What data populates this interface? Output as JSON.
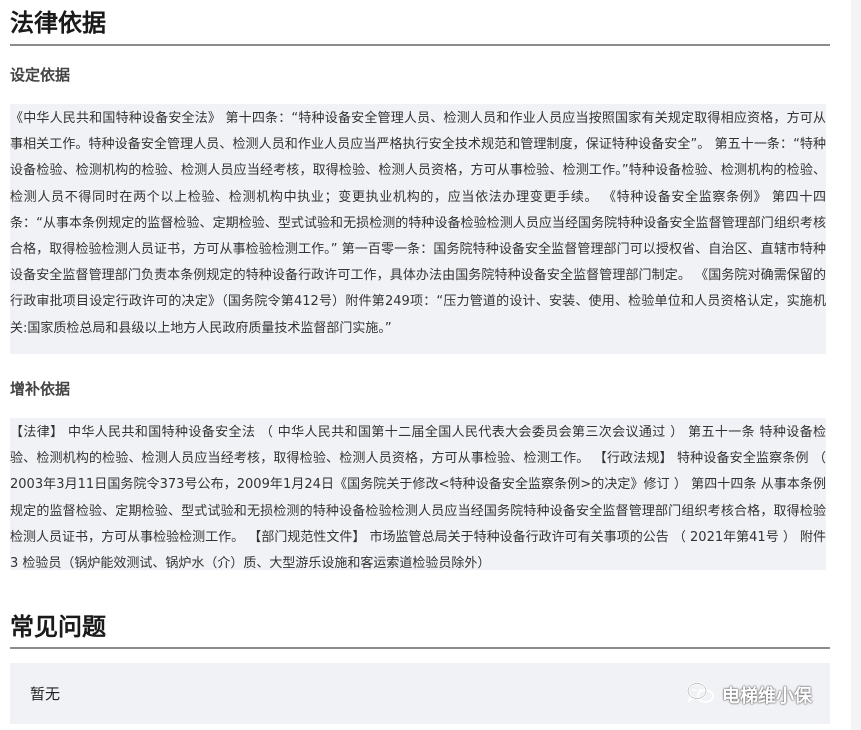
{
  "legal_basis": {
    "title": "法律依据",
    "establishing": {
      "title": "设定依据",
      "text": "《中华人民共和国特种设备安全法》 第十四条：“特种设备安全管理人员、检测人员和作业人员应当按照国家有关规定取得相应资格，方可从事相关工作。特种设备安全管理人员、检测人员和作业人员应当严格执行安全技术规范和管理制度，保证特种设备安全”。 第五十一条：“特种设备检验、检测机构的检验、检测人员应当经考核，取得检验、检测人员资格，方可从事检验、检测工作。”特种设备检验、检测机构的检验、检测人员不得同时在两个以上检验、检测机构中执业；变更执业机构的，应当依法办理变更手续。 《特种设备安全监察条例》 第四十四条：“从事本条例规定的监督检验、定期检验、型式试验和无损检测的特种设备检验检测人员应当经国务院特种设备安全监督管理部门组织考核合格，取得检验检测人员证书，方可从事检验检测工作。” 第一百零一条：国务院特种设备安全监督管理部门可以授权省、自治区、直辖市特种设备安全监督管理部门负责本条例规定的特种设备行政许可工作，具体办法由国务院特种设备安全监督管理部门制定。 《国务院对确需保留的行政审批项目设定行政许可的决定》（国务院令第412号）附件第249项：“压力管道的设计、安装、使用、检验单位和人员资格认定，实施机关:国家质检总局和县级以上地方人民政府质量技术监督部门实施。”"
    },
    "supplementary": {
      "title": "增补依据",
      "text": "【法律】 中华人民共和国特种设备安全法 （ 中华人民共和国第十二届全国人民代表大会委员会第三次会议通过 ） 第五十一条 特种设备检验、检测机构的检验、检测人员应当经考核，取得检验、检测人员资格，方可从事检验、检测工作。 【行政法规】 特种设备安全监察条例 （ 2003年3月11日国务院令373号公布，2009年1月24日《国务院关于修改<特种设备安全监察条例>的决定》修订 ） 第四十四条 从事本条例规定的监督检验、定期检验、型式试验和无损检测的特种设备检验检测人员应当经国务院特种设备安全监督管理部门组织考核合格，取得检验检测人员证书，方可从事检验检测工作。 【部门规范性文件】 市场监管总局关于特种设备行政许可有关事项的公告 （ 2021年第41号 ） 附件3 检验员（锅炉能效测试、锅炉水（介）质、大型游乐设施和客运索道检验员除外）"
    }
  },
  "faq": {
    "title": "常见问题",
    "text": "暂无"
  },
  "watermark": {
    "icon": "wechat-icon",
    "text": "电梯维小保"
  }
}
